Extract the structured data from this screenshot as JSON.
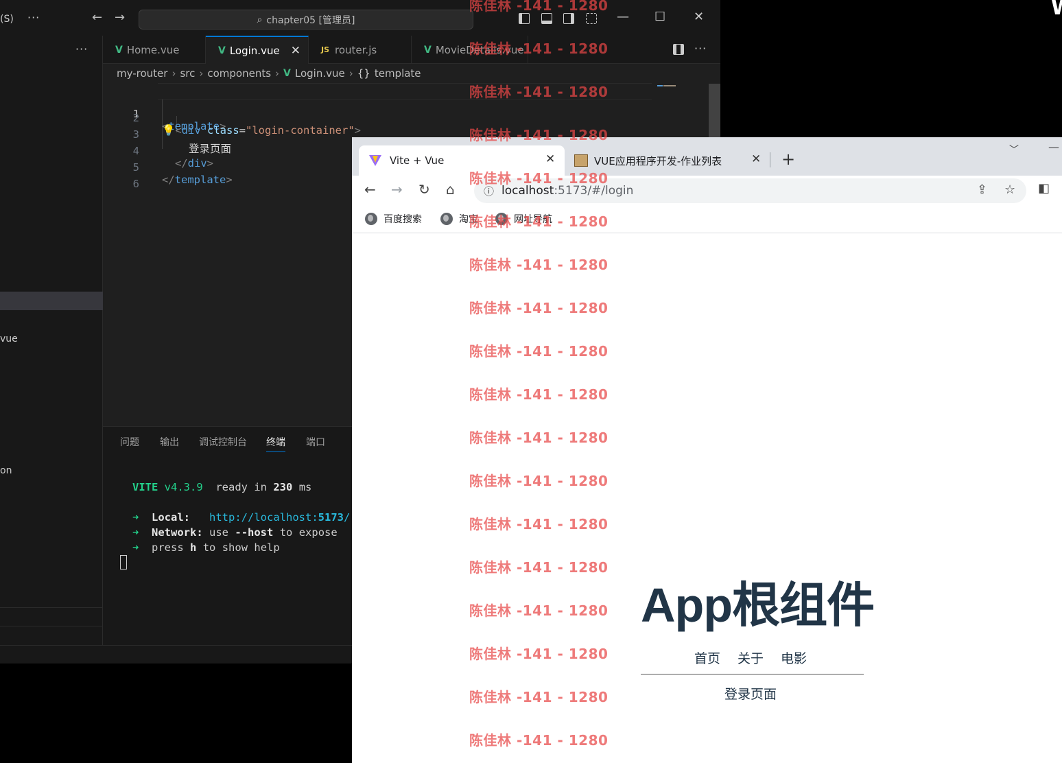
{
  "vscode": {
    "menu_fragment": "(S)",
    "search": "chapter05 [管理员]",
    "sidebar": {
      "items": [
        "vue",
        "on"
      ]
    },
    "tabs": [
      {
        "label": "Home.vue",
        "type": "vue"
      },
      {
        "label": "Login.vue",
        "type": "vue"
      },
      {
        "label": "router.js",
        "type": "js"
      },
      {
        "label": "MovieDetails.vue",
        "type": "vue"
      }
    ],
    "tab_close_glyph": "✕",
    "breadcrumb": {
      "parts": [
        "my-router",
        "src",
        "components",
        "Login.vue",
        "template"
      ]
    },
    "code": {
      "line_numbers": [
        "1",
        "2",
        "3",
        "4",
        "5",
        "6"
      ],
      "l1_open": "<",
      "l1_tag": "template",
      "l1_close": ">",
      "l2_open": "<",
      "l2_tag": "div",
      "l2_attr": "class",
      "l2_eq": "=",
      "l2_val": "\"login-container\"",
      "l2_close": ">",
      "l3_text": "登录页面",
      "l4_open": "</",
      "l4_tag": "div",
      "l4_close": ">",
      "l5_open": "</",
      "l5_tag": "template",
      "l5_close": ">"
    },
    "panel": {
      "tabs": [
        "问题",
        "输出",
        "调试控制台",
        "终端",
        "端口"
      ],
      "active_tab": "终端",
      "terminal": {
        "vite": "VITE",
        "version": "v4.3.9",
        "ready": "ready in",
        "ms_value": "230",
        "ms_unit": "ms",
        "arrow": "➜",
        "local_label": "Local:",
        "local_url_prefix": "http://localhost:",
        "local_port": "5173",
        "local_url_suffix": "/",
        "network_label": "Network:",
        "network_use": "use",
        "network_flag": "--host",
        "network_rest": "to expose",
        "press": "press",
        "press_key": "h",
        "press_rest": "to show help"
      }
    }
  },
  "corner_fragment": "W",
  "browser": {
    "tabs": [
      {
        "label": "Vite + Vue"
      },
      {
        "label": "VUE应用程序开发-作业列表"
      }
    ],
    "url_host": "localhost",
    "url_rest": ":5173/#/login",
    "bookmarks": [
      "百度搜索",
      "淘宝",
      "网址导航"
    ],
    "app": {
      "title": "App根组件",
      "nav": [
        "首页",
        "关于",
        "电影"
      ],
      "page_text": "登录页面"
    }
  },
  "watermark": "陈佳林 -141 - 1280",
  "colors": {
    "vscode_bg": "#1f1f1f",
    "accent": "#0078d4",
    "vue_green": "#41b883",
    "vite_green": "#23d18b",
    "watermark": "#e84646",
    "app_text": "#213547"
  }
}
